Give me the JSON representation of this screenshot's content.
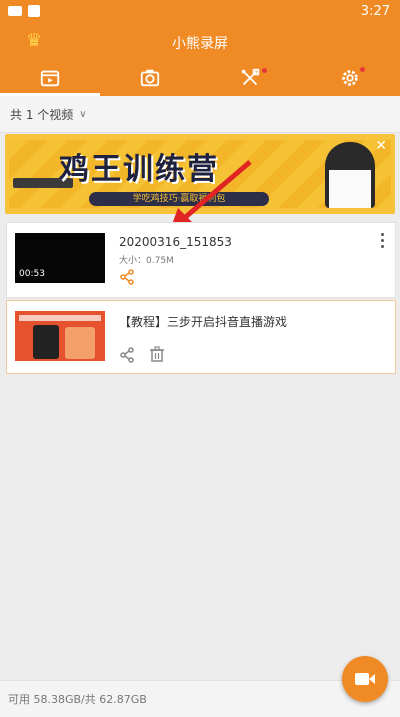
{
  "status": {
    "time": "3:27"
  },
  "header": {
    "title": "小熊录屏",
    "crown_icon": "crown-icon"
  },
  "tabs": [
    {
      "icon": "video-list-icon",
      "selected": true
    },
    {
      "icon": "camera-icon",
      "selected": false
    },
    {
      "icon": "tools-icon",
      "selected": false,
      "badge": true
    },
    {
      "icon": "gear-icon",
      "selected": false,
      "badge": true
    }
  ],
  "list": {
    "count_label": "共 1 个视频"
  },
  "banner": {
    "headline": "鸡王训练营",
    "subtitle": "学吃鸡技巧·赢取福利包"
  },
  "videos": [
    {
      "name": "20200316_151853",
      "size": "大小：0.75M",
      "duration": "00:53"
    }
  ],
  "tutorial": {
    "title": "【教程】三步开启抖音直播游戏"
  },
  "footer": {
    "storage": "可用 58.38GB/共 62.87GB"
  },
  "colors": {
    "accent": "#f08a24",
    "banner": "#f7c33b"
  }
}
